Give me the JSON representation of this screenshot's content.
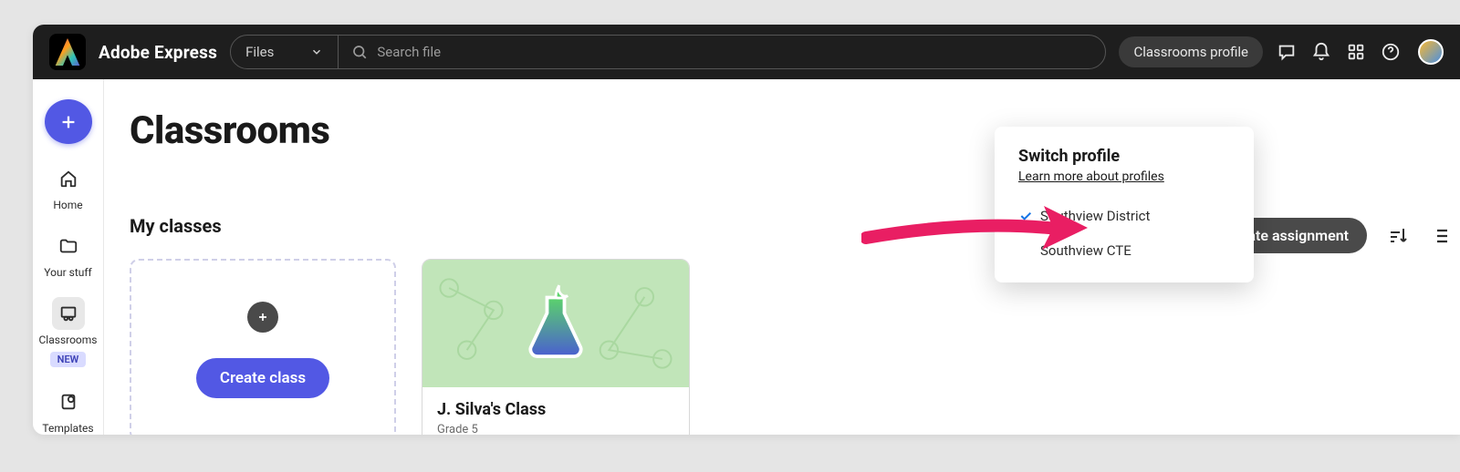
{
  "brand": "Adobe Express",
  "topbar": {
    "files_selector": "Files",
    "search_placeholder": "Search file",
    "profile_button": "Classrooms profile"
  },
  "sidebar": {
    "items": [
      {
        "label": "Home",
        "icon": "home-icon"
      },
      {
        "label": "Your stuff",
        "icon": "folder-icon"
      },
      {
        "label": "Classrooms",
        "icon": "classroom-icon",
        "active": true,
        "badge": "NEW"
      },
      {
        "label": "Templates",
        "icon": "templates-icon"
      }
    ]
  },
  "page": {
    "title": "Classrooms",
    "create_assignment": "Create assignment",
    "section_my_classes": "My classes",
    "create_class_button": "Create class"
  },
  "classes": [
    {
      "name": "J. Silva's Class",
      "grade": "Grade 5"
    }
  ],
  "profile_dropdown": {
    "title": "Switch profile",
    "learn_more": "Learn more about profiles",
    "profiles": [
      {
        "name": "Southview District",
        "selected": true
      },
      {
        "name": "Southview CTE",
        "selected": false
      }
    ]
  }
}
